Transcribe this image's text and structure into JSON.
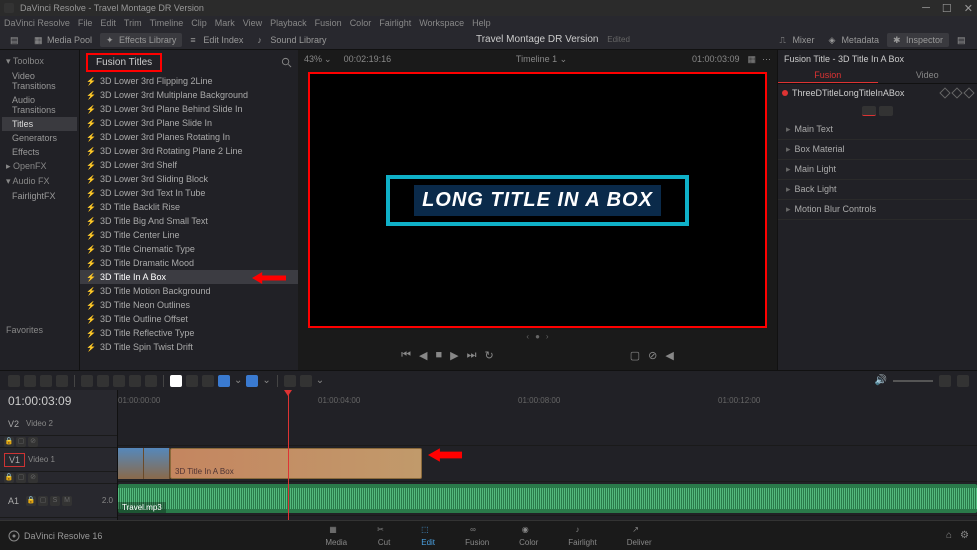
{
  "window_title": "DaVinci Resolve - Travel Montage DR Version",
  "menubar": [
    "DaVinci Resolve",
    "File",
    "Edit",
    "Trim",
    "Timeline",
    "Clip",
    "Mark",
    "View",
    "Playback",
    "Fusion",
    "Color",
    "Fairlight",
    "Workspace",
    "Help"
  ],
  "toolbar": {
    "media_pool": "Media Pool",
    "effects_library": "Effects Library",
    "edit_index": "Edit Index",
    "sound_library": "Sound Library",
    "mixer": "Mixer",
    "metadata": "Metadata",
    "inspector": "Inspector"
  },
  "center_title": "Travel Montage DR Version",
  "center_title_suffix": "Edited",
  "toolbox": {
    "header": "Toolbox",
    "items": [
      {
        "label": "Video Transitions",
        "sel": false,
        "indent": true
      },
      {
        "label": "Audio Transitions",
        "sel": false,
        "indent": true
      },
      {
        "label": "Titles",
        "sel": true,
        "indent": true
      },
      {
        "label": "Generators",
        "sel": false,
        "indent": true
      },
      {
        "label": "Effects",
        "sel": false,
        "indent": true
      }
    ],
    "openfx": "OpenFX",
    "audiofx": "Audio FX",
    "fairlightfx": "FairlightFX",
    "favorites": "Favorites"
  },
  "fusion_titles": {
    "header": "Fusion Titles",
    "items": [
      {
        "label": "3D Lower 3rd Flipping 2Line",
        "sel": false
      },
      {
        "label": "3D Lower 3rd Multiplane Background",
        "sel": false
      },
      {
        "label": "3D Lower 3rd Plane Behind Slide In",
        "sel": false
      },
      {
        "label": "3D Lower 3rd Plane Slide In",
        "sel": false
      },
      {
        "label": "3D Lower 3rd Planes Rotating In",
        "sel": false
      },
      {
        "label": "3D Lower 3rd Rotating Plane 2 Line",
        "sel": false
      },
      {
        "label": "3D Lower 3rd Shelf",
        "sel": false
      },
      {
        "label": "3D Lower 3rd Sliding Block",
        "sel": false
      },
      {
        "label": "3D Lower 3rd Text In Tube",
        "sel": false
      },
      {
        "label": "3D Title Backlit Rise",
        "sel": false
      },
      {
        "label": "3D Title Big And Small Text",
        "sel": false
      },
      {
        "label": "3D Title Center Line",
        "sel": false
      },
      {
        "label": "3D Title Cinematic Type",
        "sel": false
      },
      {
        "label": "3D Title Dramatic Mood",
        "sel": false
      },
      {
        "label": "3D Title In A Box",
        "sel": true
      },
      {
        "label": "3D Title Motion Background",
        "sel": false
      },
      {
        "label": "3D Title Neon Outlines",
        "sel": false
      },
      {
        "label": "3D Title Outline Offset",
        "sel": false
      },
      {
        "label": "3D Title Reflective Type",
        "sel": false
      },
      {
        "label": "3D Title Spin Twist Drift",
        "sel": false
      }
    ]
  },
  "viewer": {
    "zoom": "43%",
    "timecode_in": "00:02:19:16",
    "timeline_name": "Timeline 1",
    "timecode_out": "01:00:03:09",
    "preview_text": "LONG TITLE IN A BOX"
  },
  "inspector": {
    "header": "Fusion Title - 3D Title In A Box",
    "tabs": [
      "Fusion",
      "Video"
    ],
    "active_tab": 0,
    "node_name": "ThreeDTitleLongTitleInABox",
    "sections": [
      "Main Text",
      "Box Material",
      "Main Light",
      "Back Light",
      "Motion Blur Controls"
    ]
  },
  "timeline": {
    "master_tc": "01:00:03:09",
    "tracks": [
      {
        "id": "V2",
        "name": "Video 2",
        "type": "video"
      },
      {
        "id": "V1",
        "name": "Video 1",
        "type": "video",
        "sel": true
      },
      {
        "id": "A1",
        "name": "",
        "type": "audio"
      }
    ],
    "ruler_marks": [
      {
        "tc": "01:00:00:00",
        "pos": 0
      },
      {
        "tc": "01:00:04:00",
        "pos": 200
      },
      {
        "tc": "01:00:08:00",
        "pos": 400
      },
      {
        "tc": "01:00:12:00",
        "pos": 600
      }
    ],
    "clip_title_label": "3D Title In A Box",
    "clip_audio_label": "Travel.mp3",
    "audio_time": "2.0"
  },
  "footer": {
    "brand": "DaVinci Resolve 16",
    "pages": [
      "Media",
      "Cut",
      "Edit",
      "Fusion",
      "Color",
      "Fairlight",
      "Deliver"
    ],
    "active": 2
  }
}
